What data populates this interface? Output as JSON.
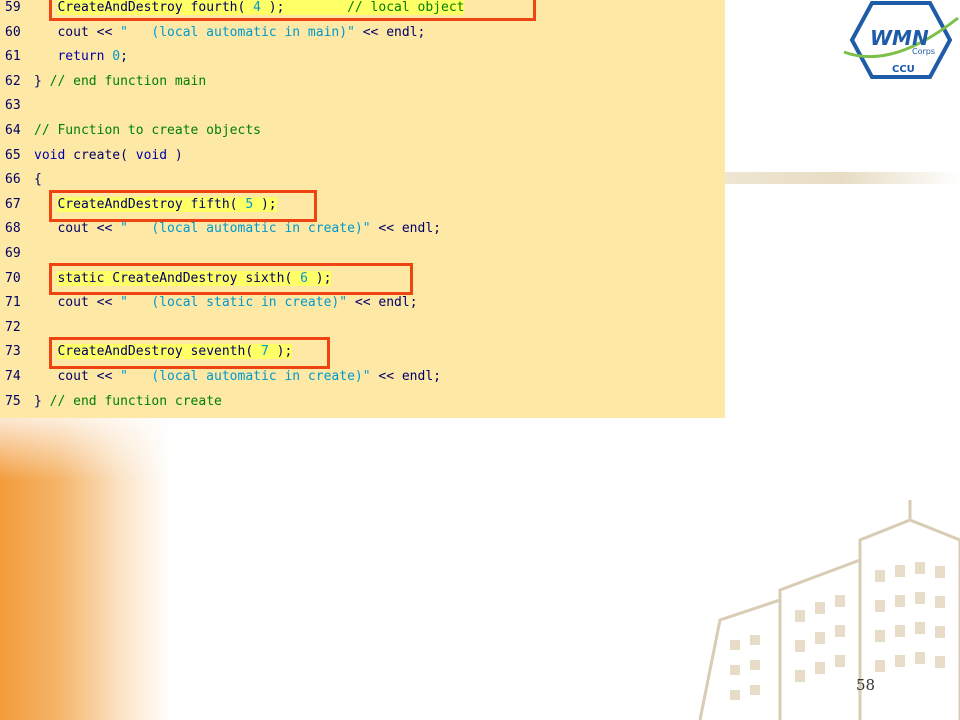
{
  "slide": {
    "number": "58",
    "logo_text": "WMN",
    "logo_sub": "Corps",
    "logo_bottom": "CCU"
  },
  "code_lines": [
    {
      "ln": "59",
      "parts": [
        {
          "t": "   ",
          "c": ""
        },
        {
          "t": "CreateAndDestroy fourth( ",
          "c": "hl"
        },
        {
          "t": "4",
          "c": "hl num"
        },
        {
          "t": " );        ",
          "c": "hl"
        },
        {
          "t": "// local object",
          "c": "hl com"
        }
      ]
    },
    {
      "ln": "60",
      "parts": [
        {
          "t": "   cout << ",
          "c": ""
        },
        {
          "t": "\"   (local automatic in main)\"",
          "c": "str"
        },
        {
          "t": " << endl;",
          "c": ""
        }
      ]
    },
    {
      "ln": "61",
      "parts": [
        {
          "t": "   ",
          "c": ""
        },
        {
          "t": "return",
          "c": "kw"
        },
        {
          "t": " ",
          "c": ""
        },
        {
          "t": "0",
          "c": "num"
        },
        {
          "t": ";",
          "c": ""
        }
      ]
    },
    {
      "ln": "62",
      "parts": [
        {
          "t": "} ",
          "c": ""
        },
        {
          "t": "// end function main",
          "c": "com"
        }
      ]
    },
    {
      "ln": "63",
      "parts": []
    },
    {
      "ln": "64",
      "parts": [
        {
          "t": "// Function to create objects",
          "c": "com"
        }
      ]
    },
    {
      "ln": "65",
      "parts": [
        {
          "t": "void",
          "c": "kw"
        },
        {
          "t": " create( ",
          "c": ""
        },
        {
          "t": "void",
          "c": "kw"
        },
        {
          "t": " )",
          "c": ""
        }
      ]
    },
    {
      "ln": "66",
      "parts": [
        {
          "t": "{",
          "c": ""
        }
      ]
    },
    {
      "ln": "67",
      "parts": [
        {
          "t": "   ",
          "c": ""
        },
        {
          "t": "CreateAndDestroy fifth( ",
          "c": "hl"
        },
        {
          "t": "5",
          "c": "hl num"
        },
        {
          "t": " );",
          "c": "hl"
        }
      ]
    },
    {
      "ln": "68",
      "parts": [
        {
          "t": "   cout << ",
          "c": ""
        },
        {
          "t": "\"   (local automatic in create)\"",
          "c": "str"
        },
        {
          "t": " << endl;",
          "c": ""
        }
      ]
    },
    {
      "ln": "69",
      "parts": []
    },
    {
      "ln": "70",
      "parts": [
        {
          "t": "   ",
          "c": ""
        },
        {
          "t": "static CreateAndDestroy sixth( ",
          "c": "hl"
        },
        {
          "t": "6",
          "c": "hl num"
        },
        {
          "t": " );",
          "c": "hl"
        }
      ]
    },
    {
      "ln": "71",
      "parts": [
        {
          "t": "   cout << ",
          "c": ""
        },
        {
          "t": "\"   (local static in create)\"",
          "c": "str"
        },
        {
          "t": " << endl;",
          "c": ""
        }
      ]
    },
    {
      "ln": "72",
      "parts": []
    },
    {
      "ln": "73",
      "parts": [
        {
          "t": "   ",
          "c": ""
        },
        {
          "t": "CreateAndDestroy seventh( ",
          "c": "hl"
        },
        {
          "t": "7",
          "c": "hl num"
        },
        {
          "t": " );",
          "c": "hl"
        }
      ]
    },
    {
      "ln": "74",
      "parts": [
        {
          "t": "   cout << ",
          "c": ""
        },
        {
          "t": "\"   (local automatic in create)\"",
          "c": "str"
        },
        {
          "t": " << endl;",
          "c": ""
        }
      ]
    },
    {
      "ln": "75",
      "parts": [
        {
          "t": "} ",
          "c": ""
        },
        {
          "t": "// end function create",
          "c": "com"
        }
      ]
    }
  ],
  "colors": {
    "code_bg": "#fde8a6",
    "highlight": "#ffff66",
    "box_border": "#ee4411",
    "comment": "#008000",
    "keyword": "#0000aa",
    "string": "#0099cc"
  }
}
